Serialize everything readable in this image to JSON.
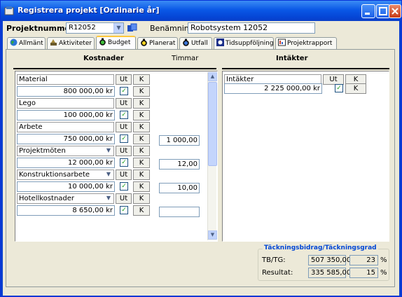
{
  "window": {
    "title": "Registrera projekt [Ordinarie år]"
  },
  "header": {
    "projektnummer_label": "Projektnummer:",
    "projektnummer_value": "R12052",
    "benamning_label": "Benämning",
    "benamning_value": "Robotsystem 12052"
  },
  "tabs": [
    {
      "label": "Allmänt",
      "icon": "globe-icon"
    },
    {
      "label": "Aktiviteter",
      "icon": "tools-icon"
    },
    {
      "label": "Budget",
      "icon": "money-bag-icon"
    },
    {
      "label": "Planerat",
      "icon": "money-bag-icon"
    },
    {
      "label": "Utfall",
      "icon": "money-bag-icon"
    },
    {
      "label": "Tidsuppföljning",
      "icon": "gear-icon"
    },
    {
      "label": "Projektrapport",
      "icon": "report-icon"
    }
  ],
  "active_tab": "Budget",
  "budget": {
    "kostnader_title": "Kostnader",
    "timmar_title": "Timmar",
    "intakter_title": "Intäkter",
    "ut_label": "Ut",
    "k_label": "K",
    "cost_rows": [
      {
        "name": "Material",
        "amount": "800 000,00 kr",
        "hours": "",
        "dropdown": false,
        "ut_checked": true
      },
      {
        "name": "Lego",
        "amount": "100 000,00 kr",
        "hours": "",
        "dropdown": false,
        "ut_checked": true
      },
      {
        "name": "Arbete",
        "amount": "750 000,00 kr",
        "hours": "1 000,00",
        "dropdown": false,
        "ut_checked": true
      },
      {
        "name": "Projektmöten",
        "amount": "12 000,00 kr",
        "hours": "12,00",
        "dropdown": true,
        "ut_checked": true
      },
      {
        "name": "Konstruktionsarbete",
        "amount": "10 000,00 kr",
        "hours": "10,00",
        "dropdown": true,
        "ut_checked": true
      },
      {
        "name": "Hotellkostnader",
        "amount": "8 650,00 kr",
        "hours": "",
        "dropdown": true,
        "ut_checked": true
      }
    ],
    "income_rows": [
      {
        "name": "Intäkter",
        "amount": "2 225 000,00 kr",
        "ut_checked": true
      }
    ]
  },
  "summary": {
    "title": "Täckningsbidrag/Täckningsgrad",
    "tbtg_label": "TB/TG:",
    "tbtg_amount": "507 350,00",
    "tbtg_percent": "23",
    "resultat_label": "Resultat:",
    "resultat_amount": "335 585,00",
    "resultat_percent": "15",
    "percent_sign": "%"
  },
  "colors": {
    "titlebar": "#0a58e6",
    "window_bg": "#ece9d8",
    "group_title": "#0046d5",
    "check": "#21a121"
  }
}
